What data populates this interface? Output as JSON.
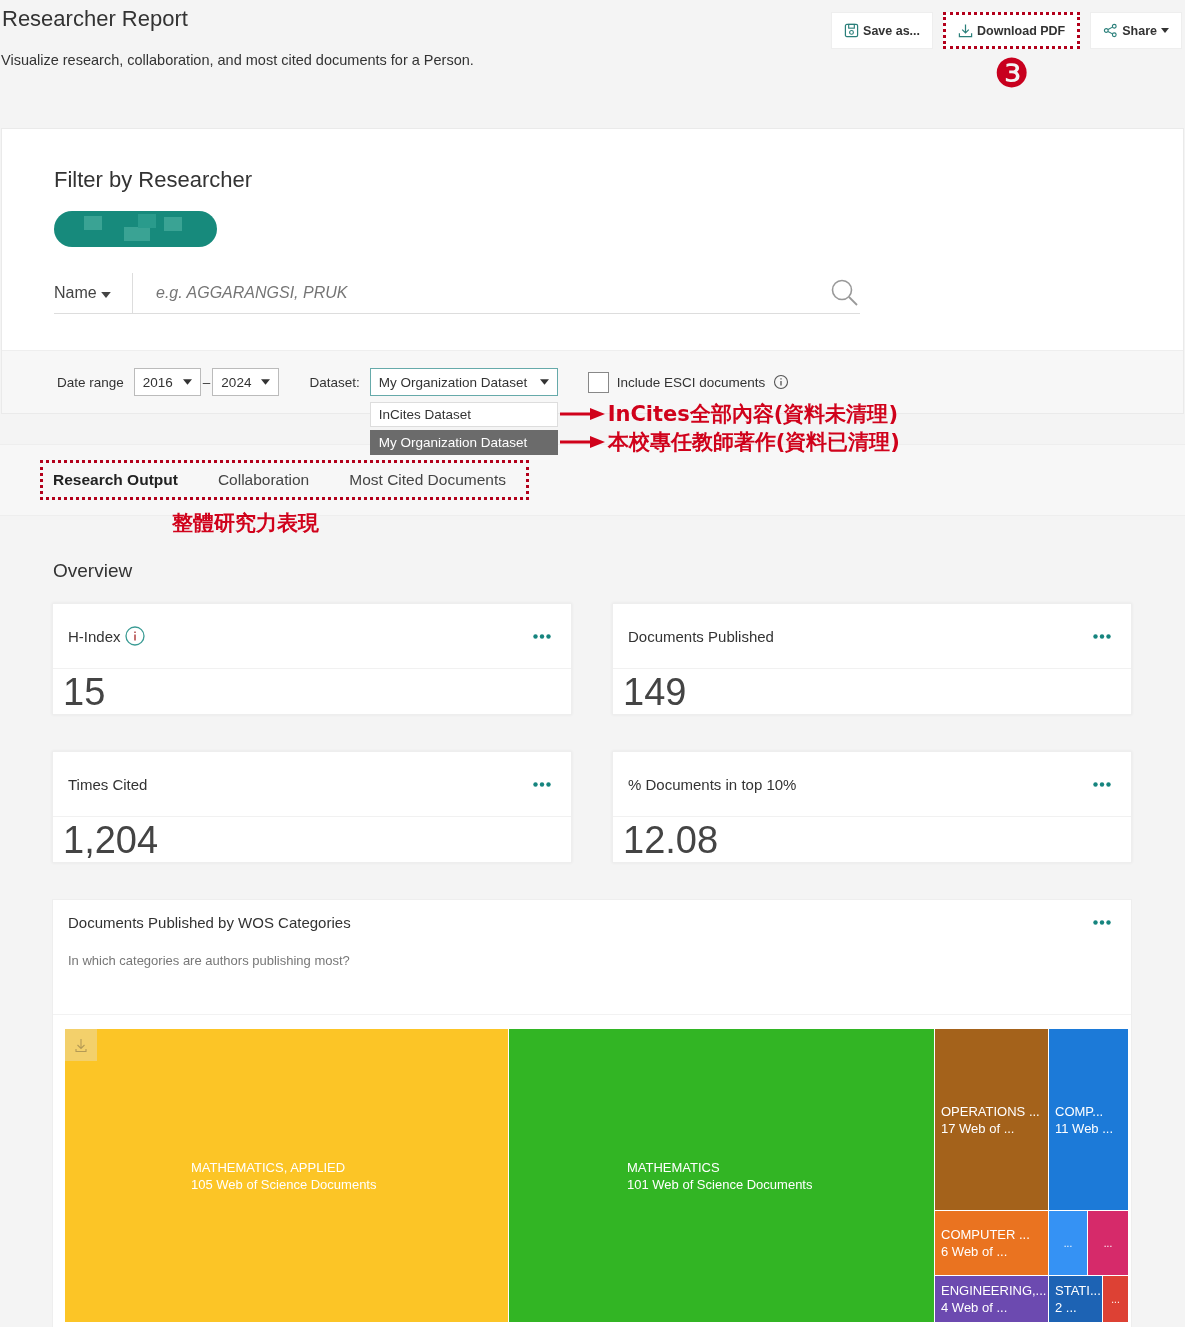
{
  "header": {
    "title": "Researcher Report",
    "subtitle": "Visualize research, collaboration, and most cited documents for a Person.",
    "actions": [
      {
        "kind": "save",
        "label": "Save as...",
        "highlighted": false,
        "caret": false
      },
      {
        "kind": "download",
        "label": "Download PDF",
        "highlighted": true,
        "caret": false
      },
      {
        "kind": "share",
        "label": "Share",
        "highlighted": false,
        "caret": true
      }
    ],
    "step_badge": "❸"
  },
  "filter": {
    "title": "Filter by Researcher",
    "search_by": "Name",
    "placeholder": "e.g. AGGARANGSI, PRUK"
  },
  "options": {
    "date_label": "Date range",
    "from": "2016",
    "separator": "–",
    "to": "2024",
    "dataset_label": "Dataset:",
    "dataset": "My Organization Dataset",
    "dataset_menu": [
      {
        "label": "InCites Dataset",
        "selected": false,
        "note": "InCites全部內容(資料未清理)"
      },
      {
        "label": "My Organization Dataset",
        "selected": true,
        "note": "本校專任教師著作(資料已清理)"
      }
    ],
    "esci": {
      "label": "Include ESCI documents",
      "checked": false
    }
  },
  "tabs": [
    {
      "label": "Research Output",
      "selected": true
    },
    {
      "label": "Collaboration",
      "selected": false
    },
    {
      "label": "Most Cited Documents",
      "selected": false
    }
  ],
  "tabs_note": "整體研究力表現",
  "overview": {
    "title": "Overview",
    "metrics": [
      {
        "label": "H-Index",
        "info": true,
        "value": "15"
      },
      {
        "label": "Documents Published",
        "info": false,
        "value": "149"
      },
      {
        "label": "Times Cited",
        "info": false,
        "value": "1,204"
      },
      {
        "label": "% Documents in top 10%",
        "info": false,
        "value": "12.08"
      }
    ]
  },
  "categories_card": {
    "title": "Documents Published by WOS Categories",
    "subtitle": "In which categories are authors publishing most?",
    "tiles": [
      {
        "name": "MATHEMATICS, APPLIED",
        "count": "105 Web of Science Documents",
        "color": "#fcc526"
      },
      {
        "name": "MATHEMATICS",
        "count": "101 Web of Science Documents",
        "color": "#32b524"
      },
      {
        "name": "OPERATIONS ...",
        "count": "17 Web of ...",
        "color": "#a4621b"
      },
      {
        "name": "COMP...",
        "count": "11 Web ...",
        "color": "#1c7ad8"
      },
      {
        "name": "COMPUTER ...",
        "count": "6 Web of ...",
        "color": "#ea7320"
      },
      {
        "name": "...",
        "color": "#3592f4"
      },
      {
        "name": "...",
        "color": "#d62a6a"
      },
      {
        "name": "ENGINEERING,...",
        "count": "4 Web of ...",
        "color": "#6c4ab0"
      },
      {
        "name": "STATI...",
        "count": "2 ...",
        "color": "#1d63b4"
      },
      {
        "name": "...",
        "color": "#dd4134"
      }
    ]
  }
}
